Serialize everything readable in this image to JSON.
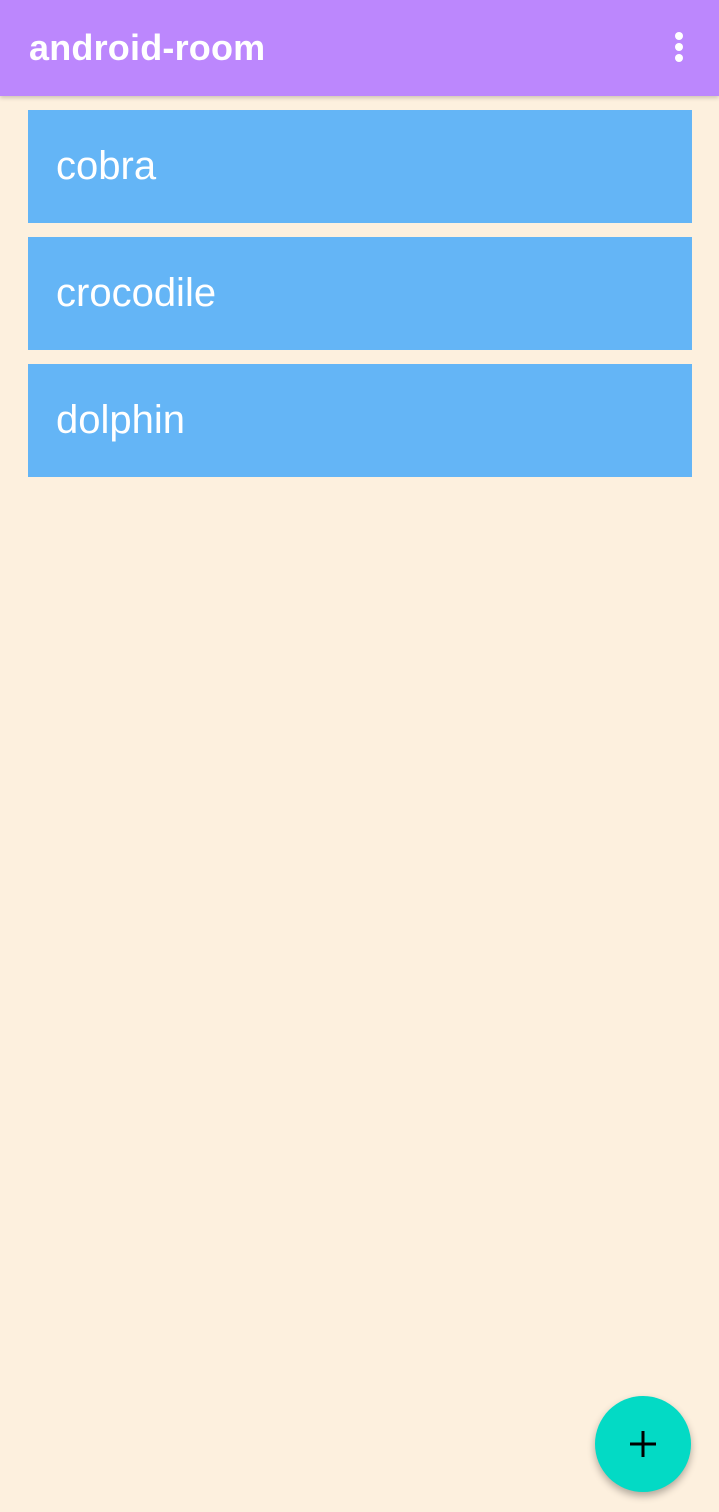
{
  "app_bar": {
    "title": "android-room",
    "menu_icon": "more-vert-icon",
    "background_color": "#bc87fd"
  },
  "list": {
    "items": [
      {
        "label": "cobra"
      },
      {
        "label": "crocodile"
      },
      {
        "label": "dolphin"
      }
    ],
    "item_color": "#64b5f6"
  },
  "fab": {
    "icon": "add-icon",
    "color": "#03dac5"
  },
  "background_color": "#fdf0de"
}
